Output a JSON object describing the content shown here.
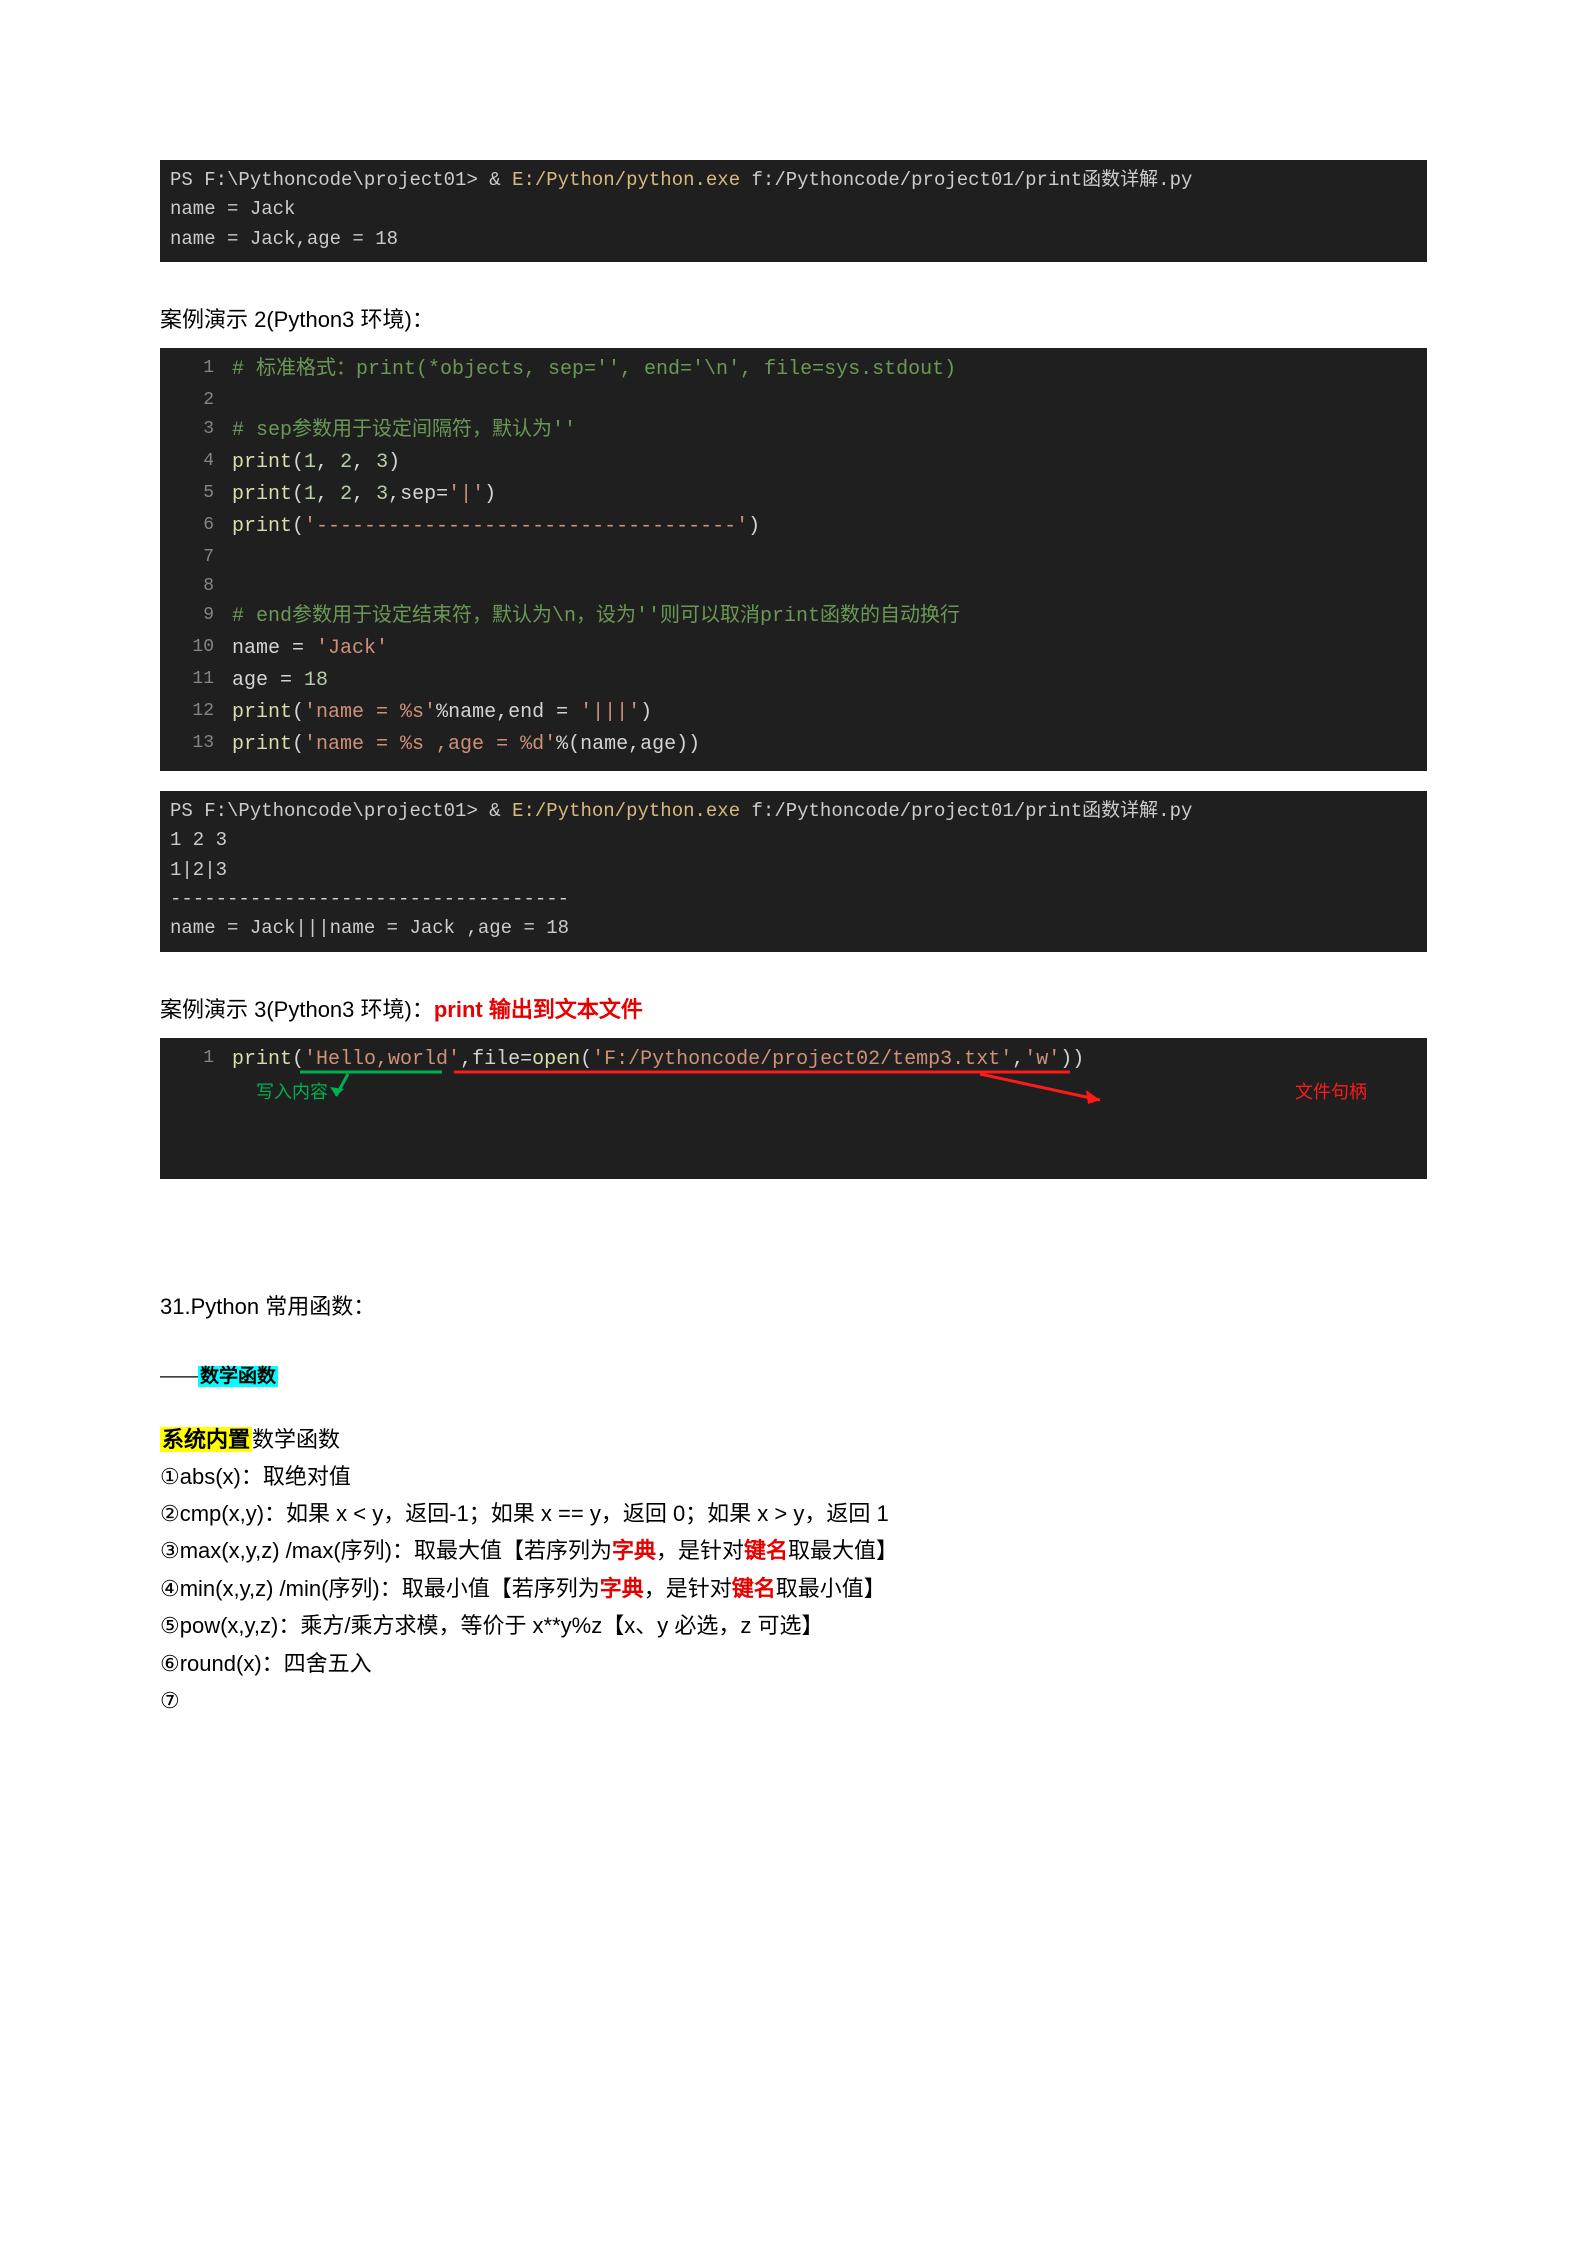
{
  "terminal1": {
    "prompt_prefix": "PS F:\\Pythoncode\\project01> & ",
    "cmd_yellow": "E:/Python/python.exe",
    "cmd_rest": " f:/Pythoncode/project01/print函数详解.py",
    "out1": "name = Jack",
    "out2": "name = Jack,age = 18"
  },
  "label2": "案例演示 2(Python3 环境)：",
  "code2": {
    "l1": "# 标准格式：print(*objects, sep='', end='\\n', file=sys.stdout)",
    "l3": "# sep参数用于设定间隔符，默认为''",
    "l4_pre": "print",
    "l4_args_a": "1",
    "l4_args_b": "2",
    "l4_args_c": "3",
    "l5_sep": "'|'",
    "l6_dash": "'-----------------------------------'",
    "l9": "# end参数用于设定结束符，默认为\\n，设为''则可以取消print函数的自动换行",
    "l10": "name = ",
    "l10s": "'Jack'",
    "l11": "age = ",
    "l11n": "18",
    "l12a": "'name = %s'",
    "l12b": "'|||'",
    "l13s": "'name = %s ,age = %d'"
  },
  "terminal2": {
    "prompt_prefix": "PS F:\\Pythoncode\\project01> & ",
    "cmd_yellow": "E:/Python/python.exe",
    "cmd_rest": " f:/Pythoncode/project01/print函数详解.py",
    "out1": "1 2 3",
    "out2": "1|2|3",
    "out3": "-----------------------------------",
    "out4": "name = Jack|||name = Jack ,age = 18"
  },
  "label3_a": "案例演示 3(Python3 环境)：",
  "label3_b": "print 输出到文本文件",
  "code3": {
    "str1": "'Hello,world'",
    "str2": "'F:/Pythoncode/project02/temp3.txt'",
    "str3": "'w'",
    "annot_write": "写入内容",
    "annot_file": "文件句柄"
  },
  "sec31": "31.Python 常用函数：",
  "hl_math": "数学函数",
  "hl_sys": "系统内置",
  "hl_sys_tail": "数学函数",
  "m1": "①abs(x)：取绝对值",
  "m2a": "②cmp(x,y)：如果 x < y，返回-1；如果 x == y，返回 0；如果 x > y，返回 1",
  "m3a": "③max(x,y,z) /max(序列)：取最大值【若序列为",
  "m3b": "字典",
  "m3c": "，是针对",
  "m3d": "键名",
  "m3e": "取最大值】",
  "m4a": "④min(x,y,z) /min(序列)：取最小值【若序列为",
  "m4b": "字典",
  "m4c": "，是针对",
  "m4d": "键名",
  "m4e": "取最小值】",
  "m5": "⑤pow(x,y,z)：乘方/乘方求模，等价于 x**y%z【x、y 必选，z 可选】",
  "m6": "⑥round(x)：四舍五入",
  "m7": "⑦"
}
